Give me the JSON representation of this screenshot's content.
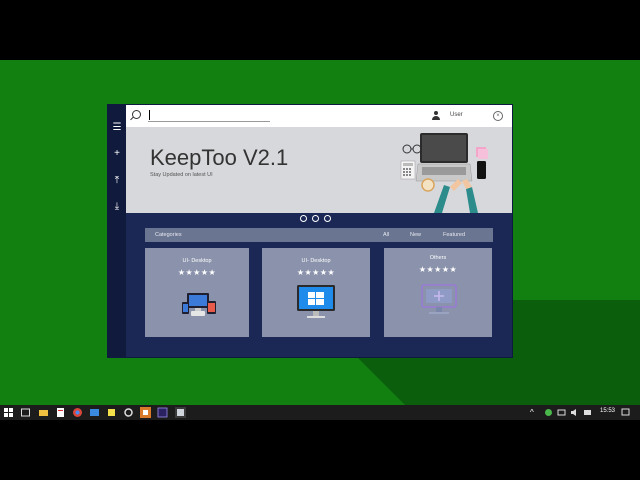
{
  "window": {
    "search": {
      "value": "",
      "placeholder": ""
    },
    "user_label": "User",
    "hero": {
      "title": "KeepToo V2.1",
      "subtitle": "Stay Updated on latest UI",
      "indicator_count": 3
    },
    "filter": {
      "label": "Categories",
      "options": [
        "All",
        "New",
        "Featured"
      ]
    },
    "cards": [
      {
        "title": "UI- Desktop",
        "stars": "★★★★★",
        "icon": "devices-icon"
      },
      {
        "title": "UI- Desktop",
        "stars": "★★★★★",
        "icon": "windows-monitor-icon"
      },
      {
        "title": "Others",
        "stars": "★★★★★",
        "icon": "monitor-add-icon"
      }
    ]
  },
  "taskbar": {
    "time": "15:53"
  },
  "colors": {
    "desktop": "#118011",
    "window_bg": "#1b2855",
    "rail": "#0f1a3d",
    "card": "#8a93ab",
    "filterbar": "#6a7592",
    "hero": "#d7d8dc"
  }
}
